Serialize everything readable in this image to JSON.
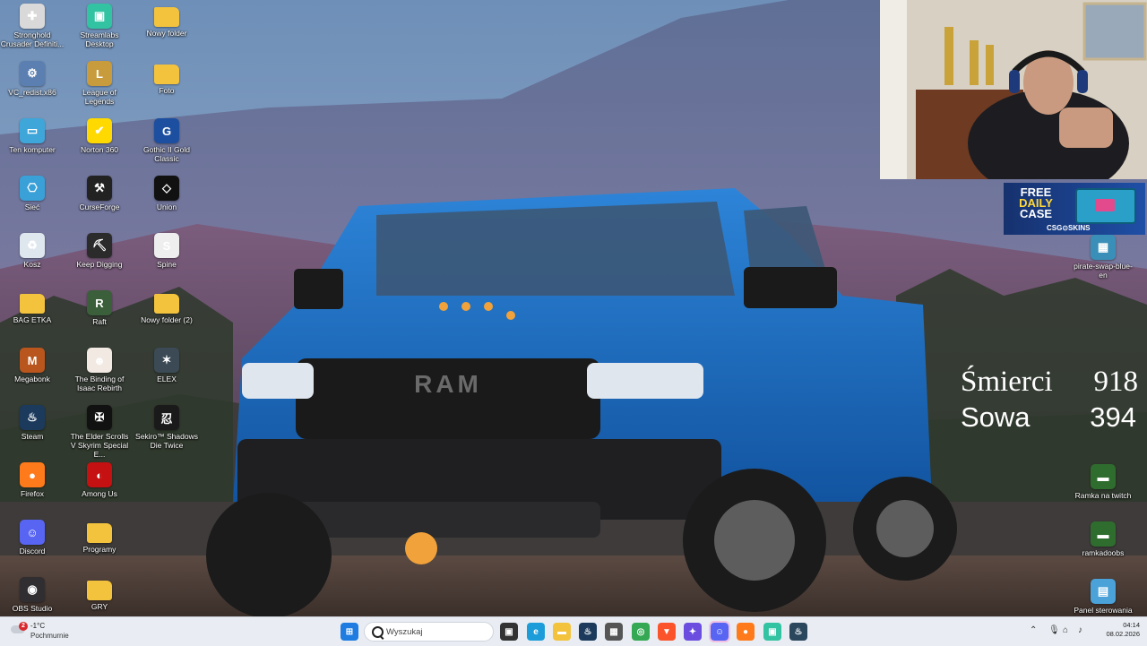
{
  "desktop_icons": [
    {
      "label": "Stronghold Crusader Definiti...",
      "icon": "stronghold-icon",
      "color": "#d9d9d9",
      "glyph": "✚"
    },
    {
      "label": "VC_redist.x86",
      "icon": "installer-icon",
      "color": "#5a7fb0",
      "glyph": "⚙"
    },
    {
      "label": "Ten komputer",
      "icon": "computer-icon",
      "color": "#3fa6d9",
      "glyph": "▭"
    },
    {
      "label": "Sieć",
      "icon": "network-icon",
      "color": "#3aa0d8",
      "glyph": "⎔"
    },
    {
      "label": "Kosz",
      "icon": "recycle-bin-icon",
      "color": "#dfe7ee",
      "glyph": "♻"
    },
    {
      "label": "BAG ETKA",
      "icon": "folder-icon",
      "color": "#f3c33d",
      "glyph": ""
    },
    {
      "label": "Megabonk",
      "icon": "megabonk-icon",
      "color": "#b8561e",
      "glyph": "M"
    },
    {
      "label": "Steam",
      "icon": "steam-icon",
      "color": "#1b3a5c",
      "glyph": "♨"
    },
    {
      "label": "Firefox",
      "icon": "firefox-icon",
      "color": "#ff7a1a",
      "glyph": "●"
    },
    {
      "label": "Discord",
      "icon": "discord-icon",
      "color": "#5865f2",
      "glyph": "☺"
    },
    {
      "label": "OBS Studio",
      "icon": "obs-icon",
      "color": "#302e31",
      "glyph": "◉"
    },
    {
      "label": "Streamlabs Desktop",
      "icon": "streamlabs-icon",
      "color": "#31c3a2",
      "glyph": "▣"
    },
    {
      "label": "League of Legends",
      "icon": "league-icon",
      "color": "#c89b3c",
      "glyph": "L"
    },
    {
      "label": "Norton 360",
      "icon": "norton-icon",
      "color": "#ffd900",
      "glyph": "✔"
    },
    {
      "label": "CurseForge",
      "icon": "curseforge-icon",
      "color": "#222222",
      "glyph": "⚒"
    },
    {
      "label": "Keep Digging",
      "icon": "keep-digging-icon",
      "color": "#2b2b2b",
      "glyph": "⛏"
    },
    {
      "label": "Raft",
      "icon": "raft-icon",
      "color": "#3b5f3b",
      "glyph": "R"
    },
    {
      "label": "The Binding of Isaac Rebirth",
      "icon": "isaac-icon",
      "color": "#f1e9e2",
      "glyph": "☻"
    },
    {
      "label": "The Elder Scrolls V Skyrim Special E...",
      "icon": "skyrim-icon",
      "color": "#111111",
      "glyph": "✠"
    },
    {
      "label": "Among Us",
      "icon": "among-us-icon",
      "color": "#c51111",
      "glyph": "◐"
    },
    {
      "label": "Programy",
      "icon": "folder-icon",
      "color": "#f3c33d",
      "glyph": ""
    },
    {
      "label": "GRY",
      "icon": "folder-icon",
      "color": "#f3c33d",
      "glyph": ""
    },
    {
      "label": "Nowy folder",
      "icon": "folder-icon",
      "color": "#f3c33d",
      "glyph": ""
    },
    {
      "label": "Foto",
      "icon": "folder-icon",
      "color": "#f3c33d",
      "glyph": ""
    },
    {
      "label": "Gothic II Gold Classic",
      "icon": "gothic-icon",
      "color": "#1d4fa0",
      "glyph": "G"
    },
    {
      "label": "Union",
      "icon": "union-icon",
      "color": "#111111",
      "glyph": "◇"
    },
    {
      "label": "Spine",
      "icon": "spine-icon",
      "color": "#eeeeee",
      "glyph": "S"
    },
    {
      "label": "Nowy folder (2)",
      "icon": "folder-icon",
      "color": "#f3c33d",
      "glyph": ""
    },
    {
      "label": "ELEX",
      "icon": "elex-icon",
      "color": "#3b4a55",
      "glyph": "✶"
    },
    {
      "label": "Sekiro™ Shadows Die Twice",
      "icon": "sekiro-icon",
      "color": "#1a1a1a",
      "glyph": "忍"
    }
  ],
  "right_icons": [
    {
      "label": "pirate-swap-blue-en",
      "icon": "image-file-icon",
      "color": "#3a8fb8",
      "glyph": "▦"
    },
    {
      "label": "Ramka na twitch",
      "icon": "frame-file-icon",
      "color": "#2f6d2f",
      "glyph": "▬"
    },
    {
      "label": "ramkadoobs",
      "icon": "frame-file-icon",
      "color": "#2f6d2f",
      "glyph": "▬"
    },
    {
      "label": "Panel sterowania",
      "icon": "control-panel-icon",
      "color": "#4aa2d8",
      "glyph": "▤"
    }
  ],
  "banner": {
    "line1": "FREE",
    "line2": "DAILY",
    "line3": "CASE",
    "brand": "CSG⊙SKINS"
  },
  "counter": {
    "label1": "Śmierci",
    "value1": "918",
    "label2": "Sowa",
    "value2": "394"
  },
  "taskbar": {
    "weather_temp": "-1°C",
    "weather_condition": "Pochmurnie",
    "weather_badge": "2",
    "search_placeholder": "Wyszukaj",
    "time": "04:14",
    "date": "08.02.2026",
    "apps": [
      {
        "name": "start-button",
        "color": "#1f7ce0",
        "glyph": "⊞"
      },
      {
        "name": "task-view-icon",
        "color": "#333333",
        "glyph": "▣"
      },
      {
        "name": "edge-icon",
        "color": "#1c9dd9",
        "glyph": "e"
      },
      {
        "name": "file-explorer-icon",
        "color": "#f3c33d",
        "glyph": "▬"
      },
      {
        "name": "steam-icon",
        "color": "#1b3a5c",
        "glyph": "♨"
      },
      {
        "name": "mail-icon",
        "color": "#555555",
        "glyph": "▦"
      },
      {
        "name": "chrome-icon",
        "color": "#34a853",
        "glyph": "◎"
      },
      {
        "name": "brave-icon",
        "color": "#fb542b",
        "glyph": "▼"
      },
      {
        "name": "ai-icon",
        "color": "#6b4ee0",
        "glyph": "✦"
      },
      {
        "name": "discord-icon",
        "color": "#5865f2",
        "glyph": "☺"
      },
      {
        "name": "firefox-icon",
        "color": "#ff7a1a",
        "glyph": "●"
      },
      {
        "name": "streamlabs-icon",
        "color": "#31c3a2",
        "glyph": "▣"
      },
      {
        "name": "steam-alt-icon",
        "color": "#2a475e",
        "glyph": "♨"
      }
    ]
  }
}
